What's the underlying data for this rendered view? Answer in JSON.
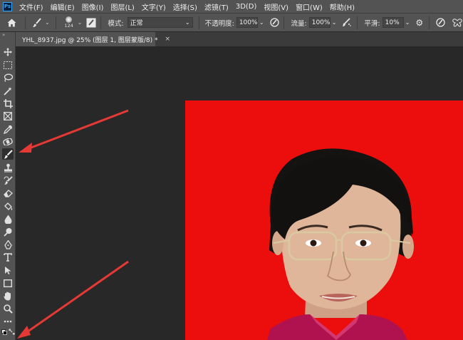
{
  "app": {
    "logo_text": "Ps"
  },
  "menu": [
    "文件(F)",
    "编辑(E)",
    "图像(I)",
    "图层(L)",
    "文字(Y)",
    "选择(S)",
    "滤镜(T)",
    "3D(D)",
    "视图(V)",
    "窗口(W)",
    "帮助(H)"
  ],
  "options": {
    "brush_size": "124",
    "mode_label": "模式:",
    "mode_value": "正常",
    "opacity_label": "不透明度:",
    "opacity_value": "100%",
    "flow_label": "流量:",
    "flow_value": "100%",
    "smoothing_label": "平滑:",
    "smoothing_value": "10%"
  },
  "document": {
    "tab_title": "YHL_8937.jpg @ 25% (图层 1, 图层蒙版/8) *",
    "close_glyph": "×"
  },
  "tools": [
    "move-tool",
    "marquee-tool",
    "lasso-tool",
    "magic-wand-tool",
    "crop-tool",
    "frame-tool",
    "eyedropper-tool",
    "healing-brush-tool",
    "brush-tool",
    "clone-stamp-tool",
    "history-brush-tool",
    "eraser-tool",
    "paint-bucket-tool",
    "blur-tool",
    "dodge-tool",
    "pen-tool",
    "type-tool",
    "path-selection-tool",
    "rectangle-tool",
    "hand-tool",
    "zoom-tool",
    "edit-toolbar",
    "default-colors",
    "swap-colors"
  ],
  "colors": {
    "ui_panel": "#535353",
    "workspace": "#282828",
    "photo_background": "#ec0d0d",
    "annotation_arrow": "#e53935"
  },
  "active_tool": "brush-tool"
}
